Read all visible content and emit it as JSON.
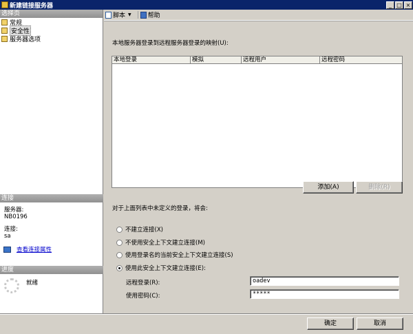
{
  "window": {
    "title": "新建链接服务器",
    "min_label": "_",
    "max_label": "□",
    "close_label": "×"
  },
  "left": {
    "select_page_header": "选择页",
    "pages": [
      {
        "label": "常规",
        "icon": "page-icon"
      },
      {
        "label": "安全性",
        "icon": "page-icon",
        "selected": true
      },
      {
        "label": "服务器选项",
        "icon": "page-icon"
      }
    ],
    "connection_header": "连接",
    "server_label": "服务器:",
    "server_value": "NB0196",
    "connection_label": "连接:",
    "connection_value": "sa",
    "view_connection_props": "查看连接属性",
    "progress_header": "进度",
    "progress_status": "就绪"
  },
  "toolbar": {
    "script_label": "脚本",
    "help_label": "帮助"
  },
  "security": {
    "mapping_label": "本地服务器登录到远程服务器登录的映射(U):",
    "columns": [
      "本地登录",
      "模拟",
      "远程用户",
      "远程密码"
    ],
    "rows": [],
    "add_button": "添加(A)",
    "remove_button": "删除(R)",
    "undefined_label": "对于上面列表中未定义的登录，将会:",
    "options": [
      {
        "label": "不建立连接(X)",
        "checked": false
      },
      {
        "label": "不使用安全上下文建立连接(M)",
        "checked": false
      },
      {
        "label": "使用登录名的当前安全上下文建立连接(S)",
        "checked": false
      },
      {
        "label": "使用此安全上下文建立连接(E):",
        "checked": true
      }
    ],
    "remote_login_label": "远程登录(R):",
    "remote_login_value": "oadev",
    "password_label": "使用密码(C):",
    "password_value": "*****"
  },
  "footer": {
    "ok_button": "确定",
    "cancel_button": "取消"
  },
  "colors": {
    "title_bar": "#0a246a",
    "dialog_face": "#d4d0c8",
    "link": "#0000cc"
  }
}
